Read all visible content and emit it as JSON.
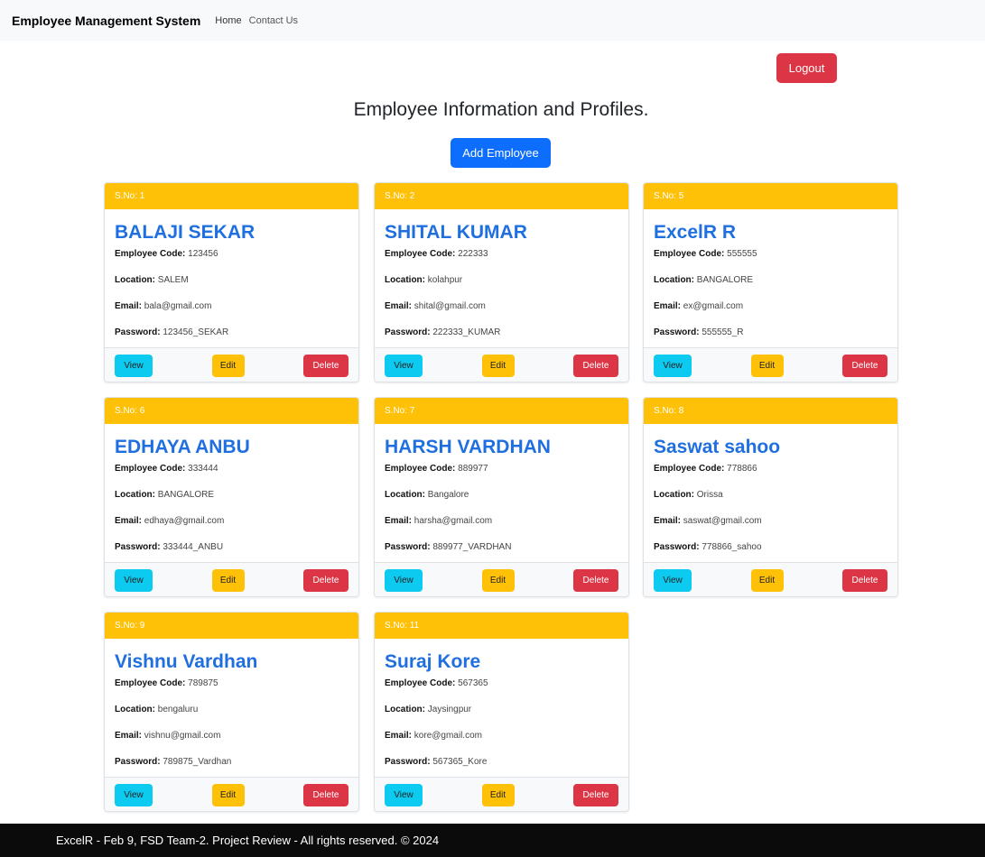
{
  "navbar": {
    "brand": "Employee Management System",
    "links": [
      "Home",
      "Contact Us"
    ]
  },
  "actions": {
    "logout_label": "Logout",
    "add_label": "Add Employee"
  },
  "page_title": "Employee Information and Profiles.",
  "field_labels": {
    "code": "Employee Code:",
    "location": "Location:",
    "email": "Email:",
    "password": "Password:"
  },
  "button_labels": {
    "view": "View",
    "edit": "Edit",
    "delete": "Delete"
  },
  "employees": [
    {
      "sno": "S.No: 1",
      "name": "BALAJI SEKAR",
      "code": "123456",
      "location": "SALEM",
      "email": "bala@gmail.com",
      "password": "123456_SEKAR"
    },
    {
      "sno": "S.No: 2",
      "name": "SHITAL KUMAR",
      "code": "222333",
      "location": "kolahpur",
      "email": "shital@gmail.com",
      "password": "222333_KUMAR"
    },
    {
      "sno": "S.No: 5",
      "name": "ExcelR R",
      "code": "555555",
      "location": "BANGALORE",
      "email": "ex@gmail.com",
      "password": "555555_R"
    },
    {
      "sno": "S.No: 6",
      "name": "EDHAYA ANBU",
      "code": "333444",
      "location": "BANGALORE",
      "email": "edhaya@gmail.com",
      "password": "333444_ANBU"
    },
    {
      "sno": "S.No: 7",
      "name": "HARSH VARDHAN",
      "code": "889977",
      "location": "Bangalore",
      "email": "harsha@gmail.com",
      "password": "889977_VARDHAN"
    },
    {
      "sno": "S.No: 8",
      "name": "Saswat sahoo",
      "code": "778866",
      "location": "Orissa",
      "email": "saswat@gmail.com",
      "password": "778866_sahoo"
    },
    {
      "sno": "S.No: 9",
      "name": "Vishnu Vardhan",
      "code": "789875",
      "location": "bengaluru",
      "email": "vishnu@gmail.com",
      "password": "789875_Vardhan"
    },
    {
      "sno": "S.No: 11",
      "name": "Suraj Kore",
      "code": "567365",
      "location": "Jaysingpur",
      "email": "kore@gmail.com",
      "password": "567365_Kore"
    }
  ],
  "footer": {
    "text": "ExcelR - Feb 9, FSD Team-2. Project Review - All rights reserved. © 2024"
  },
  "colors": {
    "navbar_bg": "#f8f9fa",
    "card_header": "#ffc107",
    "name_blue": "#1f6fe0",
    "logout": "#dc3545",
    "add": "#0d6efd",
    "view": "#0dcaf0",
    "edit": "#ffc107",
    "delete": "#dc3545",
    "footer_bg": "#0b0b0b"
  }
}
